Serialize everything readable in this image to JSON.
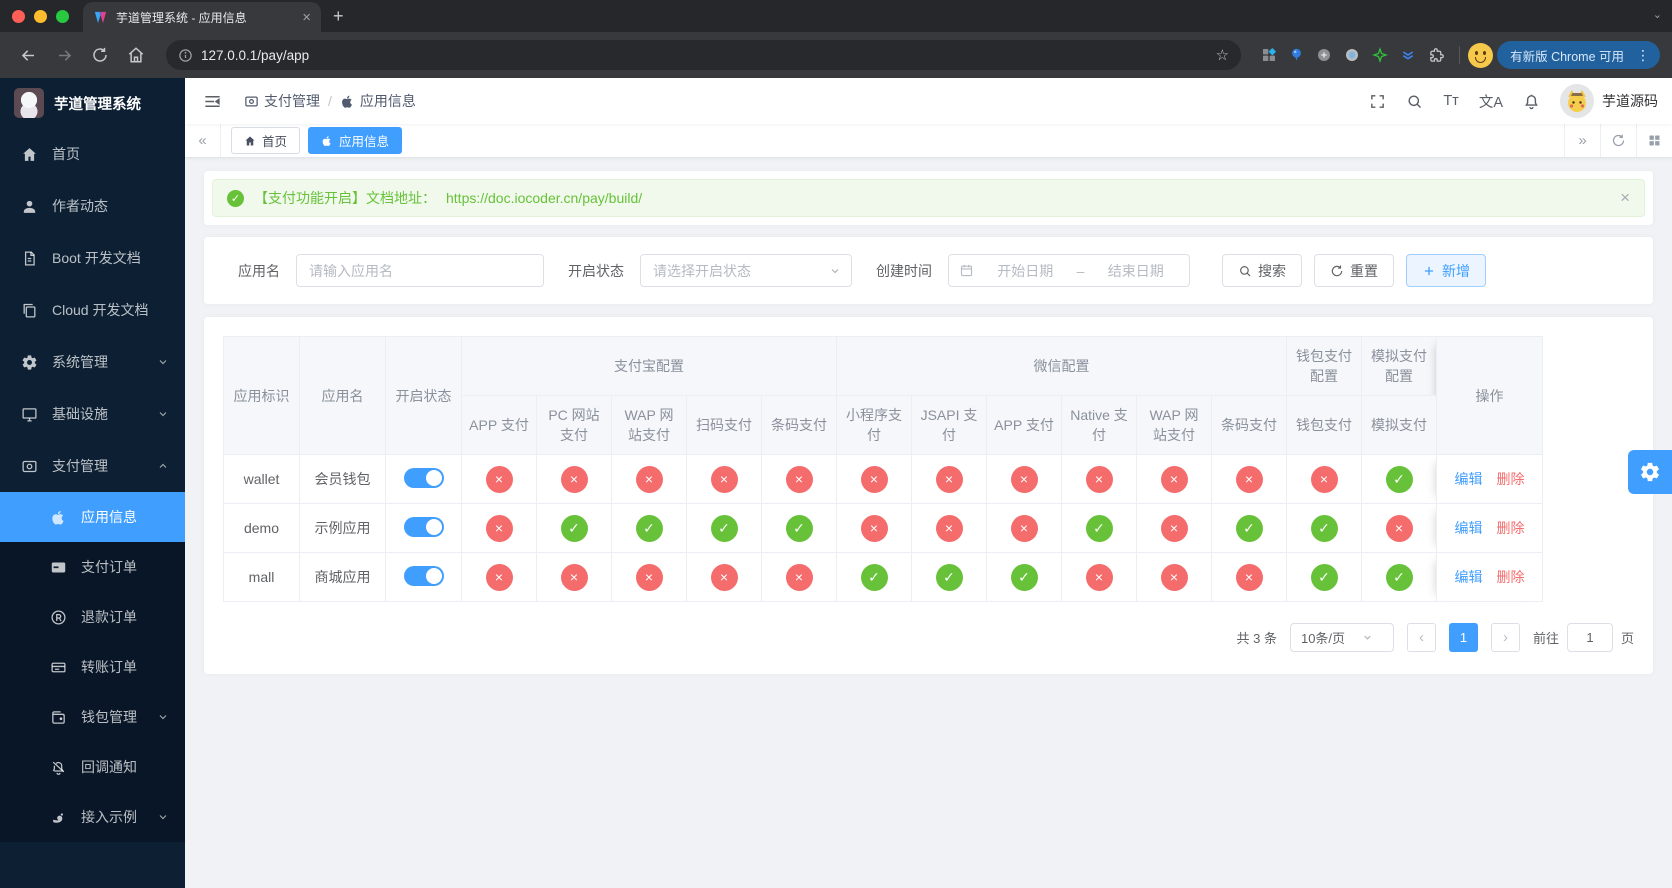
{
  "browser": {
    "tab_title": "芋道管理系统 - 应用信息",
    "url": "127.0.0.1/pay/app",
    "update_label": "有新版 Chrome 可用"
  },
  "sidebar": {
    "title": "芋道管理系统",
    "items": [
      {
        "label": "首页"
      },
      {
        "label": "作者动态"
      },
      {
        "label": "Boot 开发文档"
      },
      {
        "label": "Cloud 开发文档"
      },
      {
        "label": "系统管理"
      },
      {
        "label": "基础设施"
      },
      {
        "label": "支付管理"
      }
    ],
    "submenu": [
      {
        "label": "应用信息"
      },
      {
        "label": "支付订单"
      },
      {
        "label": "退款订单"
      },
      {
        "label": "转账订单"
      },
      {
        "label": "钱包管理"
      },
      {
        "label": "回调通知"
      },
      {
        "label": "接入示例"
      }
    ]
  },
  "header": {
    "breadcrumb_1": "支付管理",
    "breadcrumb_sep": "/",
    "breadcrumb_2": "应用信息",
    "username": "芋道源码"
  },
  "tabsbar": {
    "tabs": [
      {
        "label": "首页"
      },
      {
        "label": "应用信息"
      }
    ]
  },
  "alert": {
    "message": "【支付功能开启】文档地址：",
    "link": "https://doc.iocoder.cn/pay/build/"
  },
  "filters": {
    "app_name_label": "应用名",
    "app_name_placeholder": "请输入应用名",
    "status_label": "开启状态",
    "status_placeholder": "请选择开启状态",
    "date_label": "创建时间",
    "date_start": "开始日期",
    "date_sep": "–",
    "date_end": "结束日期",
    "search_label": "搜索",
    "reset_label": "重置",
    "create_label": "新增"
  },
  "table": {
    "fixed_headers": [
      "应用标识",
      "应用名",
      "开启状态"
    ],
    "groups": [
      {
        "label": "支付宝配置"
      },
      {
        "label": "微信配置"
      },
      {
        "label": "钱包支付配置"
      },
      {
        "label": "模拟支付配置"
      }
    ],
    "sub_headers": [
      "APP 支付",
      "PC 网站支付",
      "WAP 网站支付",
      "扫码支付",
      "条码支付",
      "小程序支付",
      "JSAPI 支付",
      "APP 支付",
      "Native 支付",
      "WAP 网站支付",
      "条码支付",
      "钱包支付",
      "模拟支付"
    ],
    "action_header": "操作",
    "rows": [
      {
        "id": "wallet",
        "name": "会员钱包",
        "enabled": true,
        "channels": [
          0,
          0,
          0,
          0,
          0,
          0,
          0,
          0,
          0,
          0,
          0,
          0,
          1
        ]
      },
      {
        "id": "demo",
        "name": "示例应用",
        "enabled": true,
        "channels": [
          0,
          1,
          1,
          1,
          1,
          0,
          0,
          0,
          1,
          0,
          1,
          1,
          0
        ]
      },
      {
        "id": "mall",
        "name": "商城应用",
        "enabled": true,
        "channels": [
          0,
          0,
          0,
          0,
          0,
          1,
          1,
          1,
          0,
          0,
          0,
          1,
          1
        ]
      }
    ],
    "actions": {
      "edit": "编辑",
      "delete": "删除"
    }
  },
  "pagination": {
    "total": "共 3 条",
    "page_size": "10条/页",
    "current_page": "1",
    "goto_prefix": "前往",
    "goto_value": "1",
    "goto_suffix": "页"
  },
  "colors": {
    "primary": "#409eff",
    "success": "#67c23a",
    "danger": "#f56c6c"
  }
}
